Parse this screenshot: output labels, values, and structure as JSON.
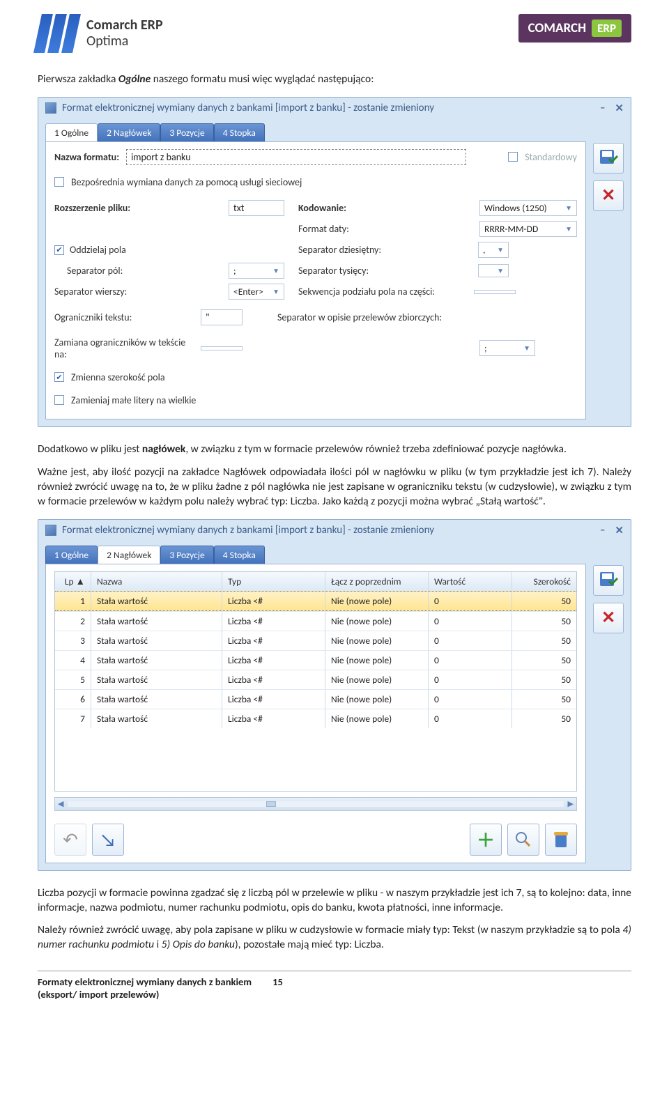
{
  "header": {
    "brand_l1": "Comarch ERP",
    "brand_l2": "Optima",
    "badge_main": "COMARCH",
    "badge_sub": "ERP"
  },
  "para1_a": "Pierwsza zakładka ",
  "para1_b": "Ogólne",
  "para1_c": " naszego formatu musi więc wyglądać następująco:",
  "win1": {
    "title": "Format elektronicznej wymiany danych z bankami [import z banku] - zostanie zmieniony",
    "tabs": [
      "1 Ogólne",
      "2 Nagłówek",
      "3 Pozycje",
      "4 Stopka"
    ],
    "lbl_name": "Nazwa formatu:",
    "val_name": "import z banku",
    "chk_std": "Standardowy",
    "chk_direct": "Bezpośrednia wymiana danych za pomocą usługi sieciowej",
    "lbl_ext": "Rozszerzenie pliku:",
    "val_ext": "txt",
    "lbl_enc": "Kodowanie:",
    "val_enc": "Windows (1250)",
    "lbl_date": "Format daty:",
    "val_date": "RRRR-MM-DD",
    "chk_sepfields": "Oddzielaj pola",
    "lbl_sepdec": "Separator dziesiętny:",
    "val_sepdec": ",",
    "lbl_seppol": "Separator pól:",
    "val_seppol": ";",
    "lbl_septh": "Separator tysięcy:",
    "val_septh": "",
    "lbl_sepwier": "Separator wierszy:",
    "val_sepwier": "<Enter>",
    "lbl_sekw": "Sekwencja podziału pola na części:",
    "val_sekw": "",
    "lbl_ogr": "Ograniczniki tekstu:",
    "val_ogr": "\"",
    "lbl_sepop": "Separator w opisie przelewów zbiorczych:",
    "lbl_zam": "Zamiana ograniczników w tekście na:",
    "val_zam": "",
    "val_sepop": ";",
    "chk_zm": "Zmienna szerokość pola",
    "chk_upper": "Zamieniaj małe litery na wielkie"
  },
  "para2_a": "Dodatkowo w pliku jest ",
  "para2_b": "nagłówek",
  "para2_c": ", w związku z tym w formacie przelewów również trzeba zdefiniować pozycje nagłówka.",
  "para3": "Ważne jest, aby ilość pozycji na zakładce Nagłówek odpowiadała ilości pól w nagłówku w pliku (w tym przykładzie jest ich 7). Należy również zwrócić uwagę na to, że w pliku żadne z pól nagłówka nie jest zapisane w ograniczniku tekstu (w cudzysłowie), w związku z tym w formacie przelewów w każdym polu należy wybrać typ: Liczba. Jako każdą z pozycji można wybrać „Stałą wartość\".",
  "win2": {
    "title": "Format elektronicznej wymiany danych z bankami [import z banku] - zostanie zmieniony",
    "tabs": [
      "1 Ogólne",
      "2 Nagłówek",
      "3 Pozycje",
      "4 Stopka"
    ],
    "cols": {
      "lp": "Lp ▲",
      "name": "Nazwa",
      "typ": "Typ",
      "lacz": "Łącz z poprzednim",
      "war": "Wartość",
      "szer": "Szerokość"
    },
    "rows": [
      {
        "lp": "1",
        "name": "Stała wartość",
        "typ": "Liczba <#",
        "lacz": "Nie (nowe pole)",
        "war": "0",
        "szer": "50"
      },
      {
        "lp": "2",
        "name": "Stała wartość",
        "typ": "Liczba <#",
        "lacz": "Nie (nowe pole)",
        "war": "0",
        "szer": "50"
      },
      {
        "lp": "3",
        "name": "Stała wartość",
        "typ": "Liczba <#",
        "lacz": "Nie (nowe pole)",
        "war": "0",
        "szer": "50"
      },
      {
        "lp": "4",
        "name": "Stała wartość",
        "typ": "Liczba <#",
        "lacz": "Nie (nowe pole)",
        "war": "0",
        "szer": "50"
      },
      {
        "lp": "5",
        "name": "Stała wartość",
        "typ": "Liczba <#",
        "lacz": "Nie (nowe pole)",
        "war": "0",
        "szer": "50"
      },
      {
        "lp": "6",
        "name": "Stała wartość",
        "typ": "Liczba <#",
        "lacz": "Nie (nowe pole)",
        "war": "0",
        "szer": "50"
      },
      {
        "lp": "7",
        "name": "Stała wartość",
        "typ": "Liczba <#",
        "lacz": "Nie (nowe pole)",
        "war": "0",
        "szer": "50"
      }
    ]
  },
  "para4": "Liczba pozycji w formacie powinna zgadzać się z liczbą pól w przelewie w pliku  - w naszym przykładzie jest ich 7, są to kolejno: data, inne informacje, nazwa podmiotu, numer rachunku podmiotu, opis do banku, kwota płatności, inne informacje.",
  "para5_a": "Należy również zwrócić uwagę, aby pola zapisane w pliku w cudzysłowie w formacie miały typ: Tekst (w naszym przykładzie są to pola ",
  "para5_b": "4) numer rachunku podmiotu",
  "para5_c": " i ",
  "para5_d": "5) Opis do banku",
  "para5_e": "), pozostałe mają mieć typ: Liczba.",
  "footer": {
    "title": "Formaty elektronicznej wymiany danych z bankiem",
    "sub": "(eksport/ import przelewów)",
    "page": "15"
  }
}
